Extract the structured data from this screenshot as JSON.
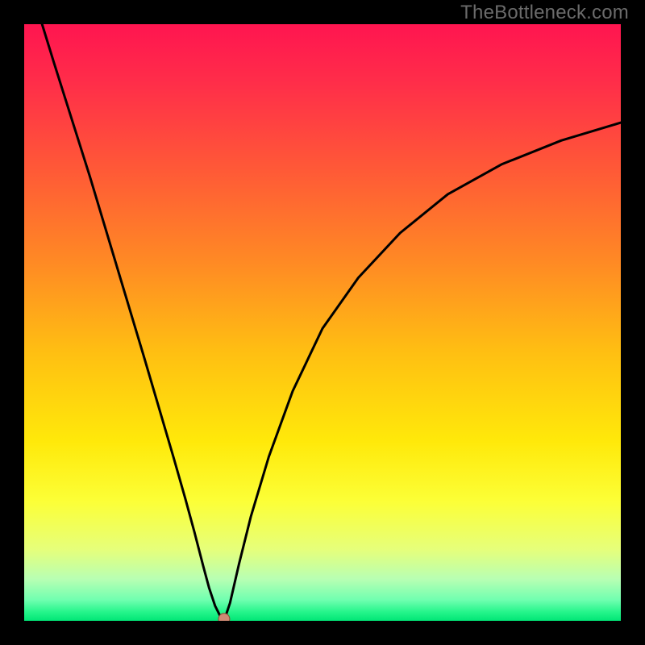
{
  "watermark": "TheBottleneck.com",
  "colors": {
    "bg": "#000000",
    "watermark": "#6b6b6b",
    "curve": "#000000",
    "dot_fill": "#cf8a74",
    "dot_stroke": "#8a4a34"
  },
  "chart_data": {
    "type": "line",
    "title": "",
    "xlabel": "",
    "ylabel": "",
    "xlim": [
      0,
      1
    ],
    "ylim": [
      0,
      1
    ],
    "annotations": [],
    "gradient_stops": [
      {
        "offset": 0.0,
        "color": "#ff1550"
      },
      {
        "offset": 0.1,
        "color": "#ff2e49"
      },
      {
        "offset": 0.25,
        "color": "#ff5b36"
      },
      {
        "offset": 0.4,
        "color": "#ff8a24"
      },
      {
        "offset": 0.55,
        "color": "#ffbf12"
      },
      {
        "offset": 0.7,
        "color": "#ffe90a"
      },
      {
        "offset": 0.8,
        "color": "#fcff37"
      },
      {
        "offset": 0.88,
        "color": "#e6ff7a"
      },
      {
        "offset": 0.93,
        "color": "#b8ffb3"
      },
      {
        "offset": 0.965,
        "color": "#70ffb0"
      },
      {
        "offset": 0.985,
        "color": "#26f58b"
      },
      {
        "offset": 1.0,
        "color": "#00e676"
      }
    ],
    "series": [
      {
        "name": "bottleneck-curve",
        "x": [
          0.03,
          0.05,
          0.08,
          0.11,
          0.14,
          0.17,
          0.2,
          0.225,
          0.25,
          0.27,
          0.285,
          0.3,
          0.31,
          0.32,
          0.33,
          0.335
        ],
        "y": [
          1.0,
          0.935,
          0.84,
          0.745,
          0.645,
          0.545,
          0.445,
          0.36,
          0.275,
          0.205,
          0.15,
          0.092,
          0.055,
          0.025,
          0.005,
          0.0
        ]
      },
      {
        "name": "bottleneck-curve-right",
        "x": [
          0.335,
          0.345,
          0.36,
          0.38,
          0.41,
          0.45,
          0.5,
          0.56,
          0.63,
          0.71,
          0.8,
          0.9,
          1.0
        ],
        "y": [
          0.0,
          0.03,
          0.095,
          0.175,
          0.275,
          0.385,
          0.49,
          0.575,
          0.65,
          0.715,
          0.765,
          0.805,
          0.835
        ]
      }
    ],
    "marker": {
      "x": 0.335,
      "y": 0.003
    }
  }
}
